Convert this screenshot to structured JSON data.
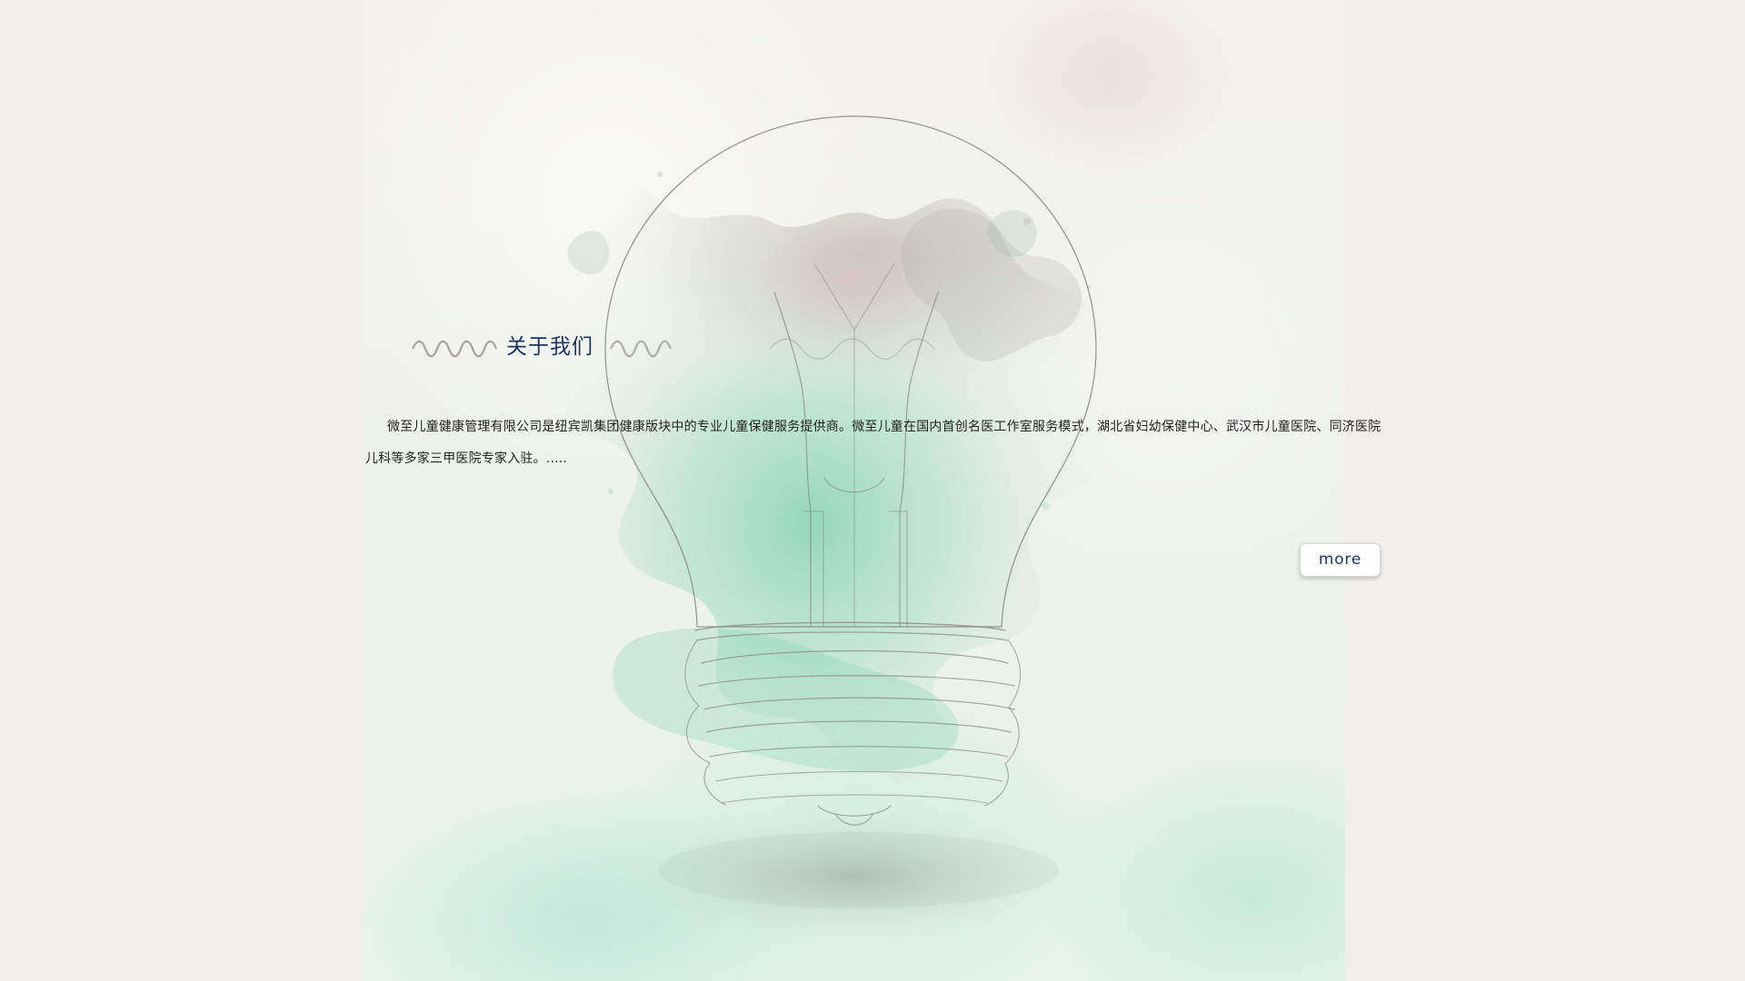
{
  "about": {
    "title": "关于我们",
    "intro": "微至儿童健康管理有限公司是纽宾凯集团健康版块中的专业儿童保健服务提供商。微至儿童在国内首创名医工作室服务模式，湖北省妇幼保健中心、武汉市儿童医院、同济医院儿科等多家三甲医院专家入驻。.....",
    "more_label": "more"
  },
  "visual": {
    "background_color": "#f2efea",
    "accent_color": "#18345d",
    "watercolor_color": "#8fd7b7",
    "bulb_line_color": "#8a8a82",
    "illustration": "light-bulb-watercolor"
  }
}
